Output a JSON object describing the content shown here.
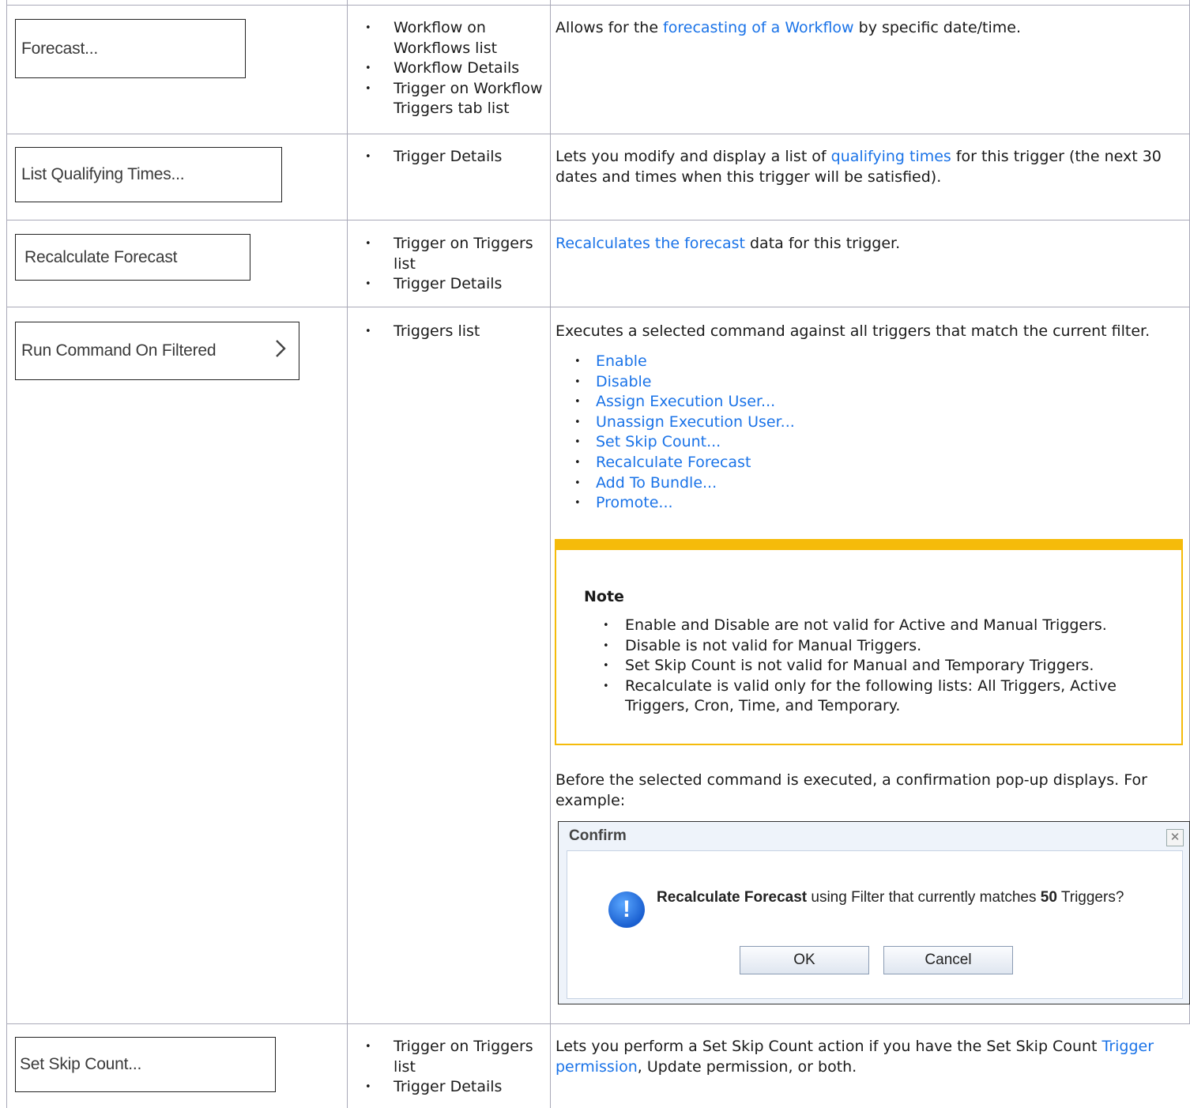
{
  "rows": [
    {
      "button_label": "Forecast...",
      "locations": [
        "Workflow on Workflows list",
        "Workflow Details",
        "Trigger on Workflow Triggers tab list"
      ],
      "desc_pre": "Allows for the ",
      "desc_link": "forecasting of a Workflow",
      "desc_post": " by specific date/time."
    },
    {
      "button_label": "List Qualifying Times...",
      "locations": [
        "Trigger Details"
      ],
      "desc_pre": "Lets you modify and display a list of ",
      "desc_link": "qualifying times",
      "desc_post": " for this trigger (the next 30 dates and times when this trigger will be satisfied)."
    },
    {
      "button_label": "Recalculate Forecast",
      "locations": [
        "Trigger on Triggers list",
        "Trigger Details"
      ],
      "desc_link": "Recalculates the forecast",
      "desc_post": " data for this trigger."
    },
    {
      "button_label": "Run Command On Filtered",
      "button_chevron": "chevron-right-icon",
      "locations": [
        "Triggers list"
      ],
      "desc_intro": "Executes a selected command against all triggers that match the current filter.",
      "commands": [
        "Enable",
        "Disable",
        "Assign Execution User...",
        "Unassign Execution User...",
        "Set Skip Count...",
        "Recalculate Forecast",
        "Add To Bundle...",
        "Promote..."
      ],
      "note": {
        "title": "Note",
        "items": [
          "Enable and Disable are not valid for Active and Manual Triggers.",
          "Disable is not valid for Manual Triggers.",
          "Set Skip Count is not valid for Manual and Temporary Triggers.",
          "Recalculate is valid only for the following lists: All Triggers, Active Triggers, Cron, Time, and Temporary."
        ]
      },
      "confirm_intro": "Before the selected command is executed, a confirmation pop-up displays. For example:",
      "dialog": {
        "title": "Confirm",
        "close": "✕",
        "icon": "!",
        "msg_bold1": "Recalculate Forecast",
        "msg_mid": " using Filter that currently matches ",
        "msg_bold2": "50",
        "msg_end": " Triggers?",
        "ok": "OK",
        "cancel": "Cancel"
      }
    },
    {
      "button_label": "Set Skip Count...",
      "locations": [
        "Trigger on Triggers list",
        "Trigger Details"
      ],
      "desc_pre": "Lets you perform a Set Skip Count action if you have the Set Skip Count ",
      "desc_link": "Trigger permission",
      "desc_post": ", Update permission, or both."
    }
  ],
  "colors": {
    "link": "#1a73e8",
    "note_border": "#f5bb0a",
    "grid": "#a9a9b8"
  }
}
